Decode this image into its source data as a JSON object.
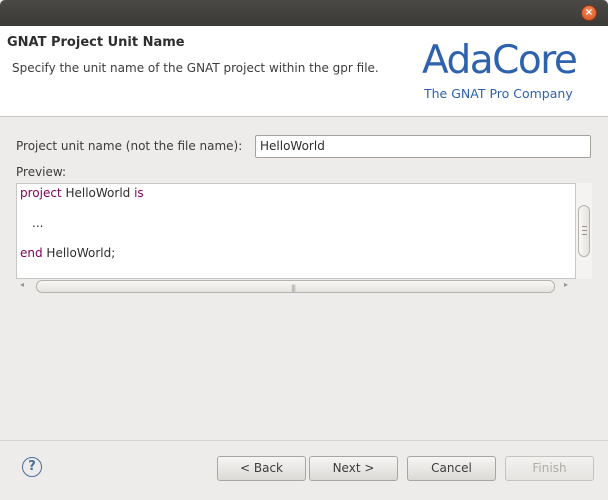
{
  "window": {
    "close_glyph": "×"
  },
  "header": {
    "title": "GNAT Project Unit Name",
    "description": "Specify the unit name of the GNAT project within the gpr file.",
    "logo": {
      "main_text": "AdaCore",
      "sub_text": "The GNAT Pro Company",
      "color": "#2e62ad"
    }
  },
  "form": {
    "unit_name_label": "Project unit name (not the file name):",
    "unit_name_value": "HelloWorld",
    "preview_label": "Preview:"
  },
  "preview": {
    "line1_kw": "project",
    "line1_name": " HelloWorld ",
    "line1_kw2": "is",
    "line2": "...",
    "line3_kw": "end",
    "line3_name": " HelloWorld;"
  },
  "scrollbar": {
    "left_arrow": "◂",
    "right_arrow": "▸",
    "grip": "|||"
  },
  "buttons": {
    "help_glyph": "?",
    "back": "< Back",
    "next": "Next >",
    "cancel": "Cancel",
    "finish": "Finish"
  },
  "colors": {
    "keyword": "#7f0055",
    "accent": "#2e62ad"
  }
}
